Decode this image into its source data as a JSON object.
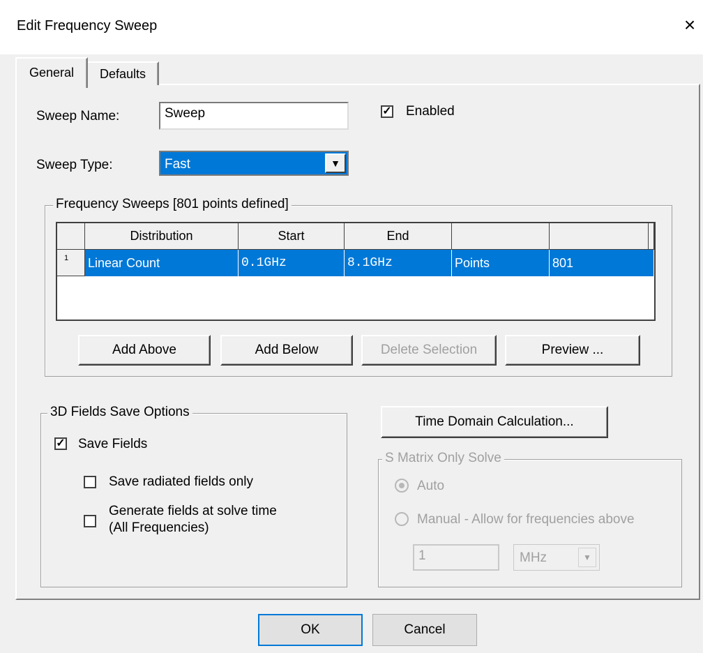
{
  "window": {
    "title": "Edit Frequency Sweep",
    "close_symbol": "×"
  },
  "tabs": [
    {
      "label": "General",
      "active": true
    },
    {
      "label": "Defaults",
      "active": false
    }
  ],
  "general": {
    "sweep_name_label": "Sweep Name:",
    "sweep_name_value": "Sweep",
    "enabled_label": "Enabled",
    "enabled_checked": true,
    "sweep_type_label": "Sweep Type:",
    "sweep_type_value": "Fast"
  },
  "frequency_sweeps": {
    "caption": "Frequency Sweeps [801 points defined]",
    "columns": [
      "Distribution",
      "Start",
      "End",
      "",
      ""
    ],
    "rows": [
      {
        "index": "1",
        "cells": [
          "Linear Count",
          "0.1GHz",
          "8.1GHz",
          "Points",
          "801"
        ]
      }
    ],
    "buttons": {
      "add_above": "Add Above",
      "add_below": "Add Below",
      "delete_selection": "Delete Selection",
      "preview": "Preview ..."
    }
  },
  "fields_save": {
    "caption": "3D Fields Save Options",
    "save_fields_label": "Save Fields",
    "save_fields_checked": true,
    "radiated_only_label": "Save radiated fields only",
    "generate_line1": "Generate fields at solve time",
    "generate_line2": "(All Frequencies)"
  },
  "time_domain": {
    "button_label": "Time Domain Calculation..."
  },
  "s_matrix": {
    "caption": "S Matrix Only Solve",
    "auto_label": "Auto",
    "manual_label": "Manual -  Allow for frequencies above",
    "value": "1",
    "unit": "MHz"
  },
  "footer": {
    "ok": "OK",
    "cancel": "Cancel"
  },
  "colors": {
    "selection": "#0078d7",
    "dialog_bg": "#f0f0f0"
  }
}
